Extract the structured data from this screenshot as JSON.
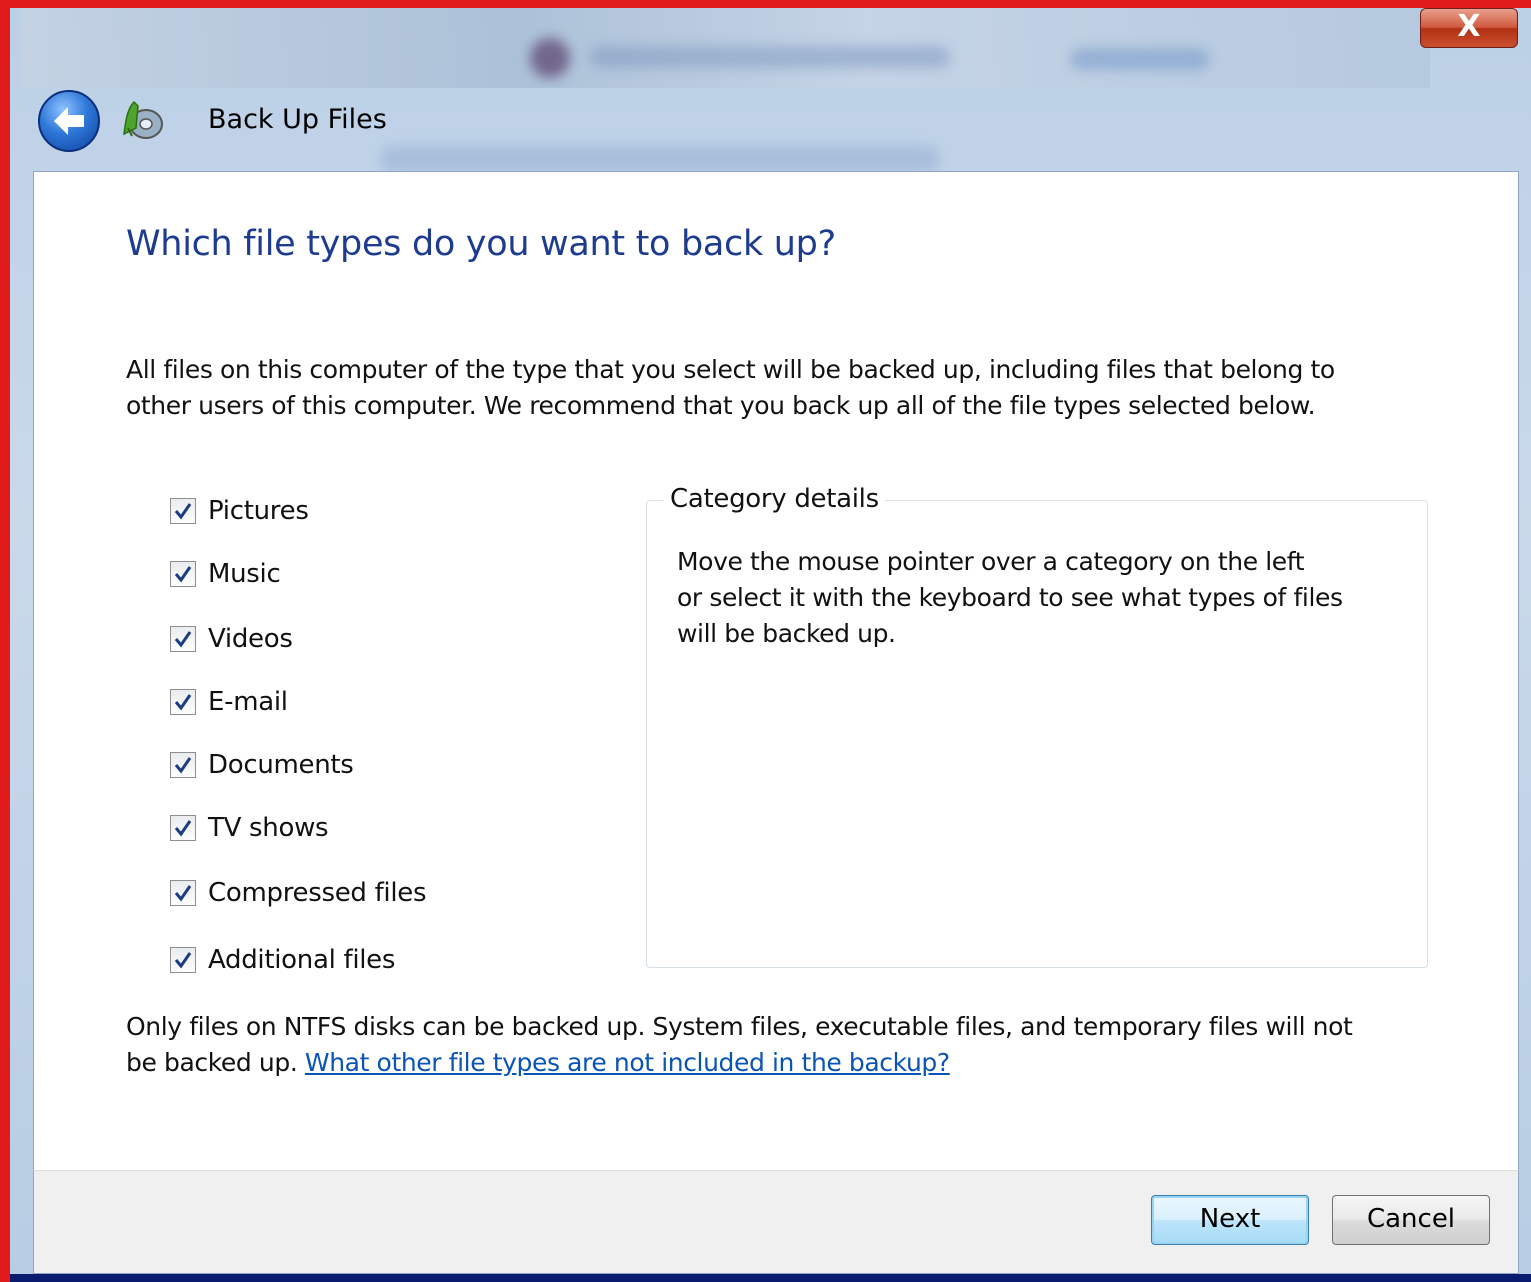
{
  "window": {
    "title": "Back Up Files",
    "close_glyph": "X"
  },
  "main": {
    "heading": "Which file types do you want to back up?",
    "intro_line1": "All files on this computer of the type that you select will be backed up, including files that belong to",
    "intro_line2": "other users of this computer. We recommend that you back up all of the file types selected below."
  },
  "file_types": [
    {
      "label": "Pictures",
      "checked": true
    },
    {
      "label": "Music",
      "checked": true
    },
    {
      "label": "Videos",
      "checked": true
    },
    {
      "label": "E-mail",
      "checked": true
    },
    {
      "label": "Documents",
      "checked": true
    },
    {
      "label": "TV shows",
      "checked": true
    },
    {
      "label": "Compressed files",
      "checked": true
    },
    {
      "label": "Additional files",
      "checked": true
    }
  ],
  "category_details": {
    "title": "Category details",
    "line1": "Move the mouse pointer over a category on the left",
    "line2": "or select it with the keyboard to see what types of files",
    "line3": "will be backed up."
  },
  "footer_note": {
    "line1": "Only files on NTFS disks can be backed up. System files, executable files, and temporary files will not",
    "line2_prefix": "be backed up. ",
    "link": "What other file types are not included in the backup?"
  },
  "buttons": {
    "next": "Next",
    "cancel": "Cancel"
  },
  "icons": {
    "back": "back-arrow-icon",
    "app": "backup-icon",
    "checkbox": "checkmark-icon"
  },
  "colors": {
    "heading": "#1e3c8f",
    "link": "#0a54b5",
    "frame_accent": "#e11b1b"
  }
}
